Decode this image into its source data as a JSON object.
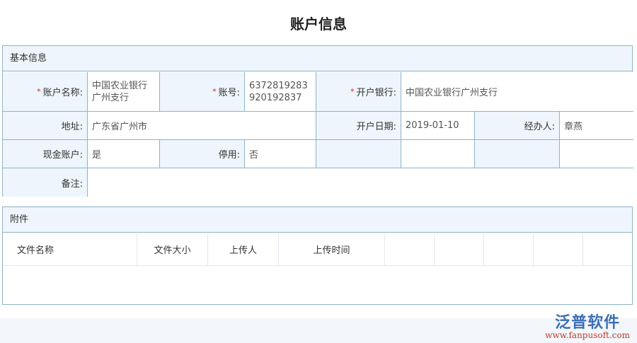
{
  "title": "账户信息",
  "basic": {
    "header": "基本信息",
    "account_name_label": "账户名称:",
    "account_name": "中国农业银行广州支行",
    "account_no_label": "账号:",
    "account_no": "6372819283920192837",
    "bank_label": "开户银行:",
    "bank": "中国农业银行广州支行",
    "address_label": "地址:",
    "address": "广东省广州市",
    "open_date_label": "开户日期:",
    "open_date": "2019-01-10",
    "handler_label": "经办人:",
    "handler": "章燕",
    "cash_label": "现金账户:",
    "cash": "是",
    "disabled_label": "停用:",
    "disabled": "否",
    "remark_label": "备注:",
    "remark": "",
    "required_mark": "*"
  },
  "attachments": {
    "header": "附件",
    "columns": [
      "文件名称",
      "文件大小",
      "上传人",
      "上传时间"
    ]
  },
  "logo": {
    "name": "泛普软件",
    "url": "www.fanpusoft.com"
  }
}
